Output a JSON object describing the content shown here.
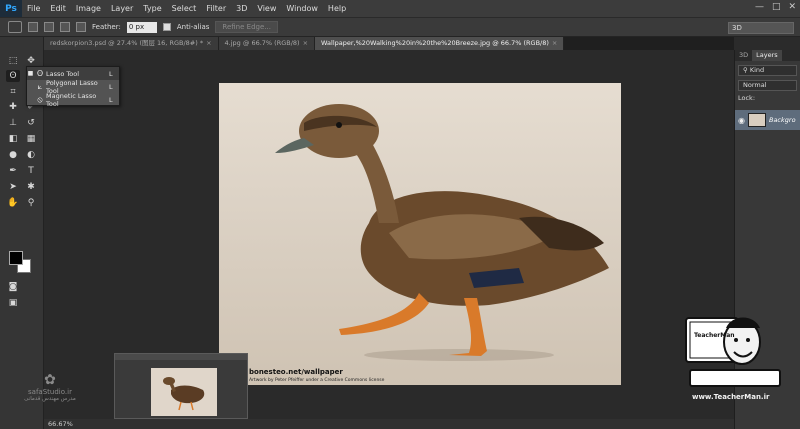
{
  "app": {
    "logo": "Ps"
  },
  "menu": [
    "File",
    "Edit",
    "Image",
    "Layer",
    "Type",
    "Select",
    "Filter",
    "3D",
    "View",
    "Window",
    "Help"
  ],
  "window_controls": [
    "—",
    "□",
    "✕"
  ],
  "options": {
    "feather_label": "Feather:",
    "feather_value": "0 px",
    "antialias_label": "Anti-alias",
    "refine_edge": "Refine Edge...",
    "workspace": "3D"
  },
  "tabs": [
    {
      "label": "redskorpion3.psd @ 27.4% (图层 16, RGB/8#) *",
      "active": false
    },
    {
      "label": "4.jpg @ 66.7% (RGB/8)",
      "active": false
    },
    {
      "label": "Wallpaper,%20Walking%20in%20the%20Breeze.jpg @ 66.7% (RGB/8)",
      "active": true
    }
  ],
  "flyout": [
    {
      "label": "Lasso Tool",
      "key": "L",
      "icon": "lasso-icon",
      "selected": true
    },
    {
      "label": "Polygonal Lasso Tool",
      "key": "L",
      "icon": "polygonal-lasso-icon",
      "selected": false
    },
    {
      "label": "Magnetic Lasso Tool",
      "key": "L",
      "icon": "magnetic-lasso-icon",
      "selected": false
    }
  ],
  "canvas": {
    "credit": "bonesteo.net/wallpaper",
    "credit_small": "Artwork by Peter Pfeiffer under a Creative Commons license"
  },
  "status": {
    "zoom": "66.67%"
  },
  "panels": {
    "tabs": [
      "3D",
      "Layers"
    ],
    "kind": "Kind",
    "blend": "Normal",
    "lock_label": "Lock:",
    "layer_name": "Backgro"
  },
  "watermarks": {
    "left_name": "safaStudio.ir",
    "left_sub": "مدرس مهندس قدمانی",
    "right_brand": "TeacherMan",
    "right_url": "www.TeacherMan.ir"
  },
  "colors": {
    "foreground": "#000000",
    "background": "#ffffff",
    "layer_selected": "#5e6c7c"
  }
}
